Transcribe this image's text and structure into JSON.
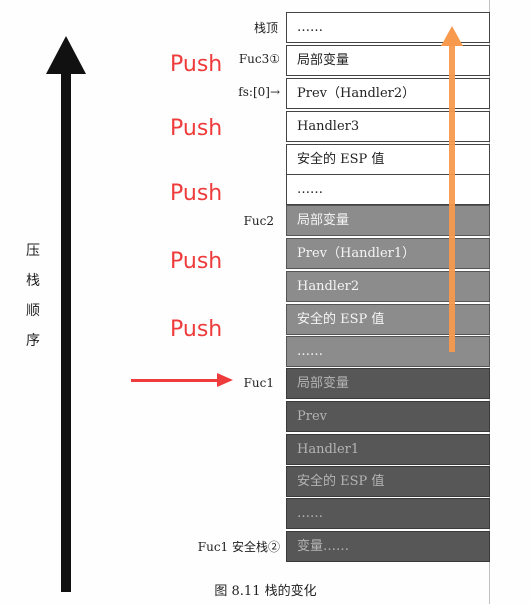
{
  "side_label": [
    "压",
    "栈",
    "顺",
    "序"
  ],
  "labels": {
    "top": "栈顶",
    "fuc3": "Fuc3①",
    "fs": "fs:[0]→",
    "fuc2": "Fuc2",
    "fuc1": "Fuc1",
    "fuc1_safe": "Fuc1 安全栈②"
  },
  "push_label": "Push",
  "cells": {
    "c1": "……",
    "c2": "局部变量",
    "c3": "Prev（Handler2）",
    "c4": "Handler3",
    "c5": "安全的 ESP 值",
    "c6": "……",
    "c7": "局部变量",
    "c8": "Prev（Handler1）",
    "c9": "Handler2",
    "c10": "安全的 ESP 值",
    "c11": "……",
    "c12": "局部变量",
    "c13": "Prev",
    "c14": "Handler1",
    "c15": "安全的 ESP 值",
    "c16": "……",
    "c17": "变量……"
  },
  "caption": "图 8.11   栈的变化",
  "colors": {
    "push": "#ee3b3b",
    "orange_arrow": "#f79a4d",
    "black_arrow": "#111111"
  }
}
